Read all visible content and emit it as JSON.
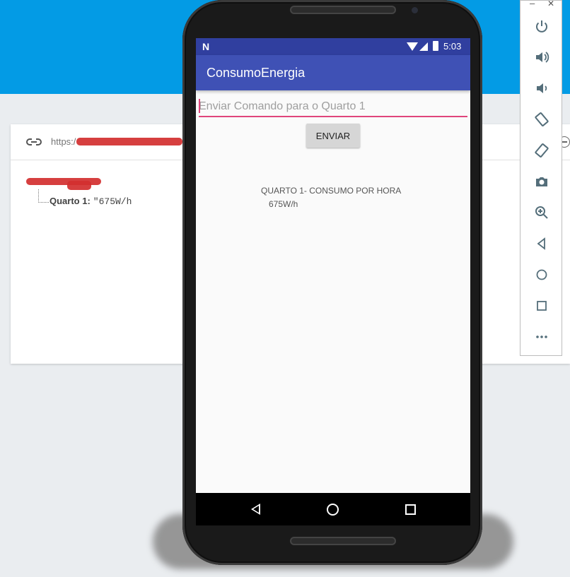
{
  "console": {
    "url_prefix": "https:/",
    "tree_root_label": "",
    "child_key": "Quarto 1:",
    "child_value": "\"675W/h"
  },
  "device": {
    "status_time": "5:03",
    "app_title": "ConsumoEnergia",
    "input_placeholder": "Enviar Comando para o Quarto 1",
    "send_button_label": "ENVIAR",
    "consumo_label": "QUARTO 1- CONSUMO POR HORA",
    "consumo_value": "675W/h"
  },
  "emulator_toolbar": {
    "minimize_label": "–",
    "close_label": "✕",
    "icons": [
      "power-icon",
      "volume-up-icon",
      "volume-down-icon",
      "rotate-left-icon",
      "rotate-right-icon",
      "camera-icon",
      "zoom-icon",
      "back-icon",
      "home-icon",
      "overview-icon",
      "more-icon"
    ]
  },
  "colors": {
    "top_band": "#039be5",
    "app_bar": "#3f51b5",
    "status_bar": "#303f9f",
    "input_underline": "#e0457b"
  }
}
